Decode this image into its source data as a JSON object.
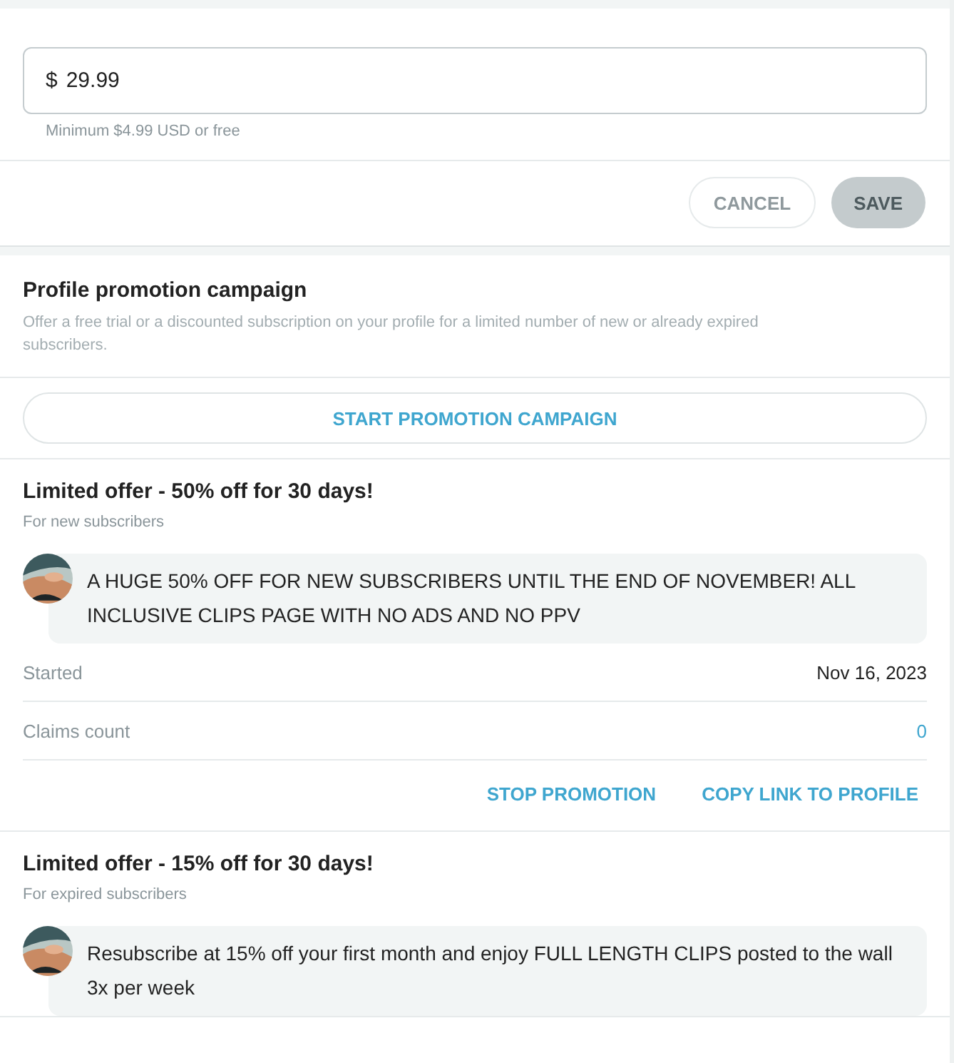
{
  "price_field": {
    "currency": "$",
    "value": "29.99",
    "hint": "Minimum $4.99 USD or free"
  },
  "form_buttons": [
    {
      "label": "CANCEL",
      "kind": "outline",
      "disabled": true
    },
    {
      "label": "SAVE",
      "kind": "filled",
      "disabled": true
    }
  ],
  "promotion": {
    "title": "Profile promotion campaign",
    "description": "Offer a free trial or a discounted subscription on your profile for a limited number of new or already expired subscribers.",
    "button": "START PROMOTION CAMPAIGN"
  },
  "offers": [
    {
      "title": "Limited offer - 50% off for 30 days!",
      "audience": "For new subscribers",
      "message": "A HUGE 50% OFF FOR NEW SUBSCRIBERS UNTIL THE END OF NOVEMBER! ALL INCLUSIVE CLIPS PAGE WITH NO ADS AND NO PPV",
      "details": [
        {
          "label": "Started",
          "value": "Nov 16, 2023",
          "kind": "plain"
        },
        {
          "label": "Claims count",
          "value": "0",
          "kind": "link"
        }
      ],
      "actions": [
        "STOP PROMOTION",
        "COPY LINK TO PROFILE"
      ]
    },
    {
      "title": "Limited offer - 15% off for 30 days!",
      "audience": "For expired subscribers",
      "message": "Resubscribe at 15% off your first month and enjoy FULL LENGTH CLIPS posted to the wall 3x per week"
    }
  ]
}
